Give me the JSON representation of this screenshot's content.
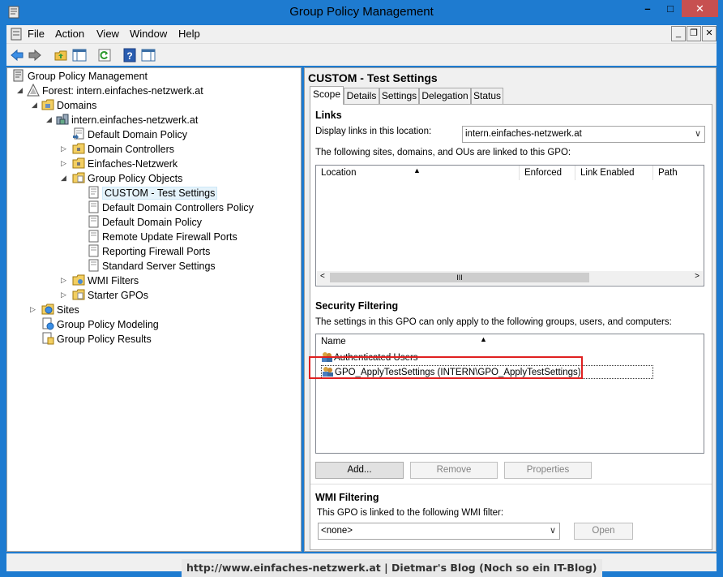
{
  "window": {
    "title": "Group Policy Management",
    "controls": {
      "minimize": "–",
      "maximize": "□",
      "close": "✕"
    }
  },
  "menubar": {
    "items": [
      "File",
      "Action",
      "View",
      "Window",
      "Help"
    ]
  },
  "tree": {
    "nodes": [
      {
        "label": "Group Policy Management",
        "icon": "gpm-root-icon"
      },
      {
        "label": "Forest: intern.einfaches-netzwerk.at",
        "icon": "forest-icon"
      },
      {
        "label": "Domains",
        "icon": "domains-folder-icon"
      },
      {
        "label": "intern.einfaches-netzwerk.at",
        "icon": "domain-icon"
      },
      {
        "label": "Default Domain Policy",
        "icon": "gpo-link-icon"
      },
      {
        "label": "Domain Controllers",
        "icon": "ou-folder-icon"
      },
      {
        "label": "Einfaches-Netzwerk",
        "icon": "ou-folder-icon"
      },
      {
        "label": "Group Policy Objects",
        "icon": "gpo-folder-icon"
      },
      {
        "label": "CUSTOM - Test Settings",
        "icon": "gpo-icon"
      },
      {
        "label": "Default Domain Controllers Policy",
        "icon": "gpo-icon"
      },
      {
        "label": "Default Domain Policy",
        "icon": "gpo-icon"
      },
      {
        "label": "Remote Update Firewall Ports",
        "icon": "gpo-icon"
      },
      {
        "label": "Reporting Firewall Ports",
        "icon": "gpo-icon"
      },
      {
        "label": "Standard Server Settings",
        "icon": "gpo-icon"
      },
      {
        "label": "WMI Filters",
        "icon": "wmi-folder-icon"
      },
      {
        "label": "Starter GPOs",
        "icon": "starter-folder-icon"
      },
      {
        "label": "Sites",
        "icon": "sites-icon"
      },
      {
        "label": "Group Policy Modeling",
        "icon": "modeling-icon"
      },
      {
        "label": "Group Policy Results",
        "icon": "results-icon"
      }
    ]
  },
  "details": {
    "title": "CUSTOM - Test Settings",
    "tabs": [
      "Scope",
      "Details",
      "Settings",
      "Delegation",
      "Status"
    ],
    "active_tab": "Scope",
    "links": {
      "heading": "Links",
      "display_label": "Display links in this location:",
      "location_value": "intern.einfaches-netzwerk.at",
      "description": "The following sites, domains, and OUs are linked to this GPO:",
      "columns": [
        "Location",
        "Enforced",
        "Link Enabled",
        "Path"
      ],
      "scroll_thumb": "III"
    },
    "security": {
      "heading": "Security Filtering",
      "description": "The settings in this GPO can only apply to the following groups, users, and computers:",
      "column": "Name",
      "items": [
        "Authenticated Users",
        "GPO_ApplyTestSettings (INTERN\\GPO_ApplyTestSettings)"
      ],
      "buttons": {
        "add": "Add...",
        "remove": "Remove",
        "properties": "Properties"
      }
    },
    "wmi": {
      "heading": "WMI Filtering",
      "description": "This GPO is linked to the following WMI filter:",
      "filter_value": "<none>",
      "open_button": "Open"
    }
  },
  "watermark": "http://www.einfaches-netzwerk.at | Dietmar's Blog (Noch so ein IT-Blog)",
  "colors": {
    "frame": "#1e7bd0",
    "highlight": "#e02020",
    "selection": "#e5f3fb"
  }
}
